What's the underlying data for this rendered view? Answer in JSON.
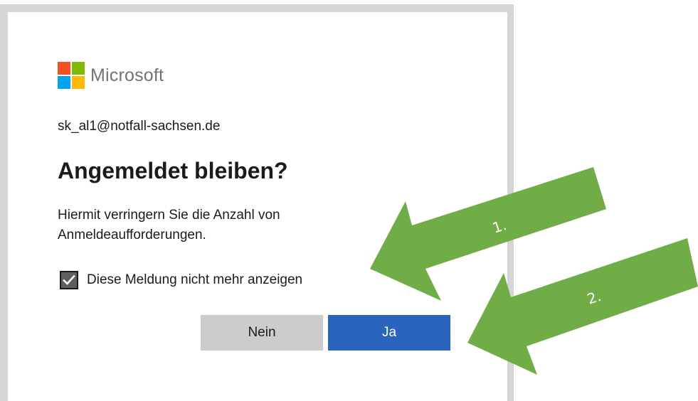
{
  "logo": {
    "text": "Microsoft",
    "colors": [
      "#f25022",
      "#7fba00",
      "#00a4ef",
      "#ffb900"
    ]
  },
  "account": "sk_al1@notfall-sachsen.de",
  "title": "Angemeldet bleiben?",
  "description": "Hiermit verringern Sie die Anzahl von Anmeldeaufforderungen.",
  "checkbox": {
    "label": "Diese Meldung nicht mehr anzeigen",
    "checked": true
  },
  "buttons": {
    "no": "Nein",
    "yes": "Ja"
  },
  "annotations": {
    "arrow1": "1.",
    "arrow2": "2.",
    "color": "#70ad47"
  },
  "colors": {
    "primary": "#2964bd",
    "secondary": "#cccccc"
  }
}
